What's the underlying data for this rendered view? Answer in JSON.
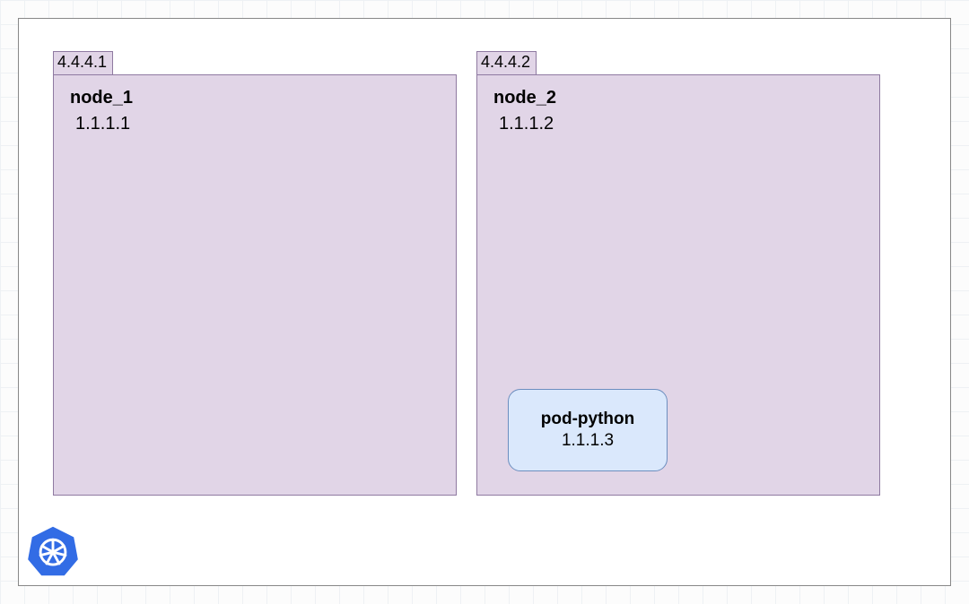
{
  "cluster": {
    "nodes": [
      {
        "external_ip": "4.4.4.1",
        "name": "node_1",
        "internal_ip": "1.1.1.1",
        "pods": []
      },
      {
        "external_ip": "4.4.4.2",
        "name": "node_2",
        "internal_ip": "1.1.1.2",
        "pods": [
          {
            "name": "pod-python",
            "ip": "1.1.1.3"
          }
        ]
      }
    ]
  },
  "colors": {
    "node_fill": "#e1d5e7",
    "node_stroke": "#8f7aa1",
    "pod_fill": "#dae8fc",
    "pod_stroke": "#6c8ebf",
    "k8s_blue": "#326ce5"
  }
}
